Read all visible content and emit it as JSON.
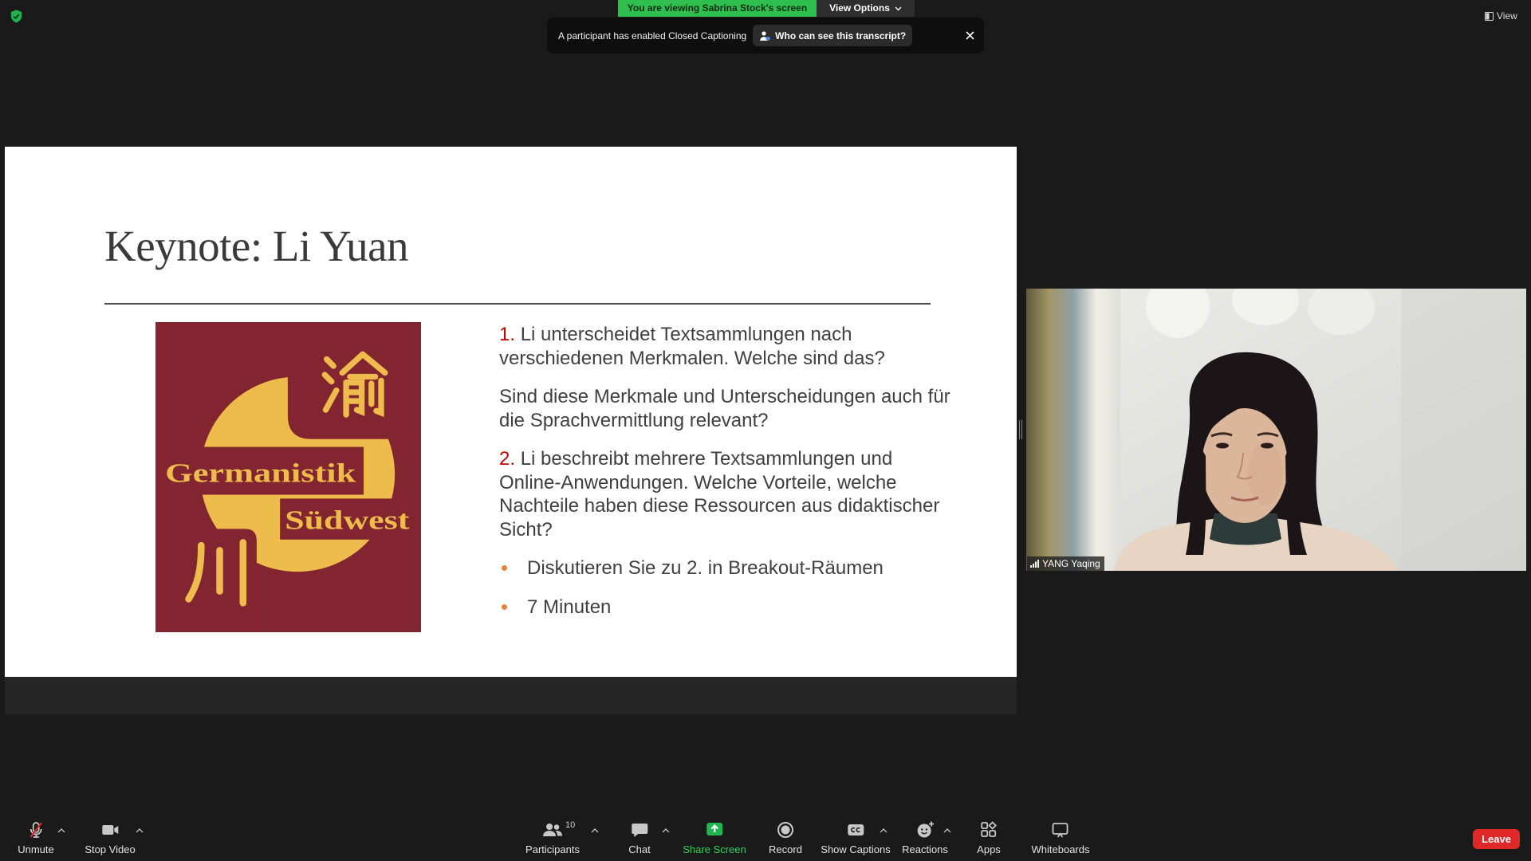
{
  "app": {
    "security_icon": "shield-check-icon"
  },
  "banner": {
    "viewing_text": "You are viewing Sabrina Stock's screen",
    "view_options_label": "View Options",
    "view_options_icon": "chevron-down-icon"
  },
  "toast": {
    "message": "A participant has enabled Closed Captioning",
    "button_label": "Who can see this transcript?",
    "button_icon": "person-captions-icon",
    "close_icon": "close-icon"
  },
  "view_menu": {
    "label": "View",
    "icon": "view-layout-icon"
  },
  "slide": {
    "title": "Keynote: Li Yuan",
    "logo": {
      "text_top": "Germanistik",
      "text_bottom": "Südwest",
      "characters": [
        "渝",
        "川"
      ],
      "background_color": "#832530",
      "foreground_color": "#eebb4d"
    },
    "items": [
      {
        "number": "1.",
        "text": "Li unterscheidet Textsammlungen nach verschiedenen Merkmalen. Welche sind das?"
      },
      {
        "text": "Sind diese Merkmale und Unterscheidungen auch für die Sprachvermittlung relevant?"
      },
      {
        "number": "2.",
        "text": "Li beschreibt mehrere Textsammlungen und Online-Anwendungen. Welche Vorteile, welche Nachteile haben diese Ressourcen aus didaktischer Sicht?"
      }
    ],
    "bullets": [
      "Diskutieren Sie zu 2. in Breakout-Räumen",
      "7 Minuten"
    ]
  },
  "video": {
    "participant_name": "YANG Yaqing",
    "signal_icon": "signal-bars-icon"
  },
  "toolbar": {
    "unmute": {
      "label": "Unmute",
      "icon": "mic-off-icon"
    },
    "stop_video": {
      "label": "Stop Video",
      "icon": "video-camera-icon"
    },
    "participants": {
      "label": "Participants",
      "count": "10",
      "icon": "participants-icon"
    },
    "chat": {
      "label": "Chat",
      "icon": "chat-icon"
    },
    "share_screen": {
      "label": "Share Screen",
      "icon": "share-screen-icon"
    },
    "record": {
      "label": "Record",
      "icon": "record-icon"
    },
    "show_captions": {
      "label": "Show Captions",
      "icon": "closed-captions-icon"
    },
    "reactions": {
      "label": "Reactions",
      "icon": "reactions-icon"
    },
    "apps": {
      "label": "Apps",
      "icon": "apps-icon"
    },
    "whiteboards": {
      "label": "Whiteboards",
      "icon": "whiteboard-icon"
    },
    "leave": {
      "label": "Leave"
    }
  },
  "colors": {
    "background": "#1a1a1a",
    "banner_green": "#2fbf4f",
    "share_green": "#22c55e",
    "leave_red": "#e02828",
    "mute_slash_red": "#e02828",
    "slide_number_red": "#c00000",
    "bullet_orange": "#e8833a"
  }
}
